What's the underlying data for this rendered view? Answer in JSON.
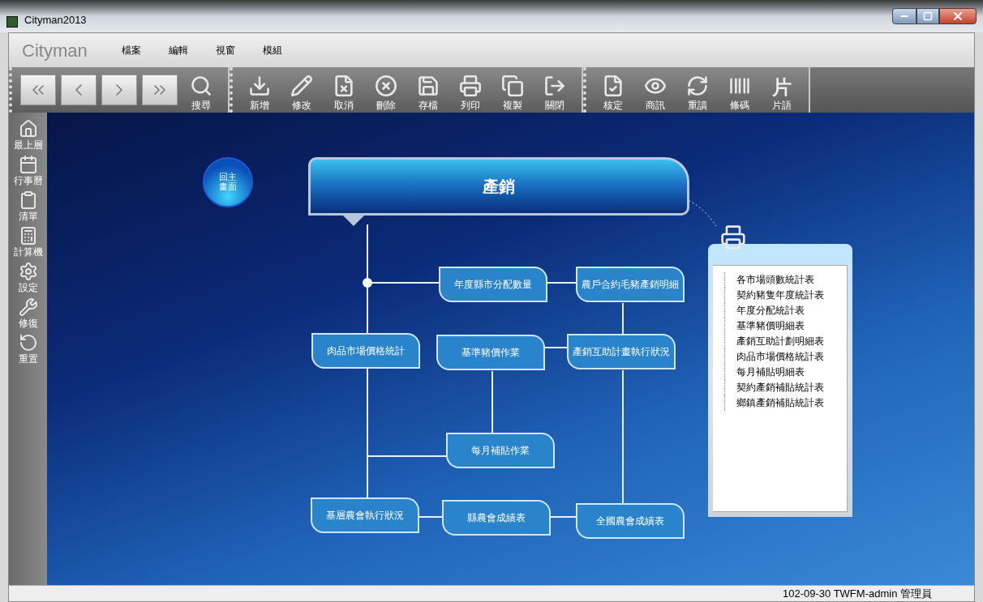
{
  "window": {
    "title": "Cityman2013"
  },
  "menu": {
    "brand": "Cityman",
    "items": [
      "檔案",
      "編輯",
      "視窗",
      "模組"
    ]
  },
  "toolbar": {
    "groups": [
      [
        {
          "kind": "nav"
        },
        {
          "kind": "nav"
        },
        {
          "kind": "nav"
        },
        {
          "kind": "nav"
        },
        {
          "kind": "tool",
          "label": "搜尋"
        }
      ],
      [
        {
          "kind": "tool",
          "label": "新增"
        },
        {
          "kind": "tool",
          "label": "修改"
        },
        {
          "kind": "tool",
          "label": "取消"
        },
        {
          "kind": "tool",
          "label": "刪除"
        },
        {
          "kind": "tool",
          "label": "存檔"
        },
        {
          "kind": "tool",
          "label": "列印"
        },
        {
          "kind": "tool",
          "label": "複製"
        },
        {
          "kind": "tool",
          "label": "關閉"
        }
      ],
      [
        {
          "kind": "tool",
          "label": "核定"
        },
        {
          "kind": "tool",
          "label": "商訊"
        },
        {
          "kind": "tool",
          "label": "重讀"
        },
        {
          "kind": "tool",
          "label": "條碼"
        },
        {
          "kind": "glyph",
          "glyph": "片",
          "label": "片語"
        }
      ]
    ]
  },
  "sidebar": {
    "items": [
      "最上層",
      "行事曆",
      "清單",
      "計算機",
      "設定",
      "修復",
      "重置"
    ]
  },
  "home_button": {
    "label": "回主畫面"
  },
  "diagram": {
    "title": "產銷",
    "nodes": [
      "年度縣市分配數量",
      "農戶合約毛豬產銷明細",
      "肉品市場價格統計",
      "基準豬價作業",
      "產銷互助計畫執行狀況",
      "每月補貼作業",
      "基層農會執行狀況",
      "縣農會成績表",
      "全國農會成績表"
    ]
  },
  "reports": {
    "items": [
      "各市場頭數統計表",
      "契約豬隻年度統計表",
      "年度分配統計表",
      "基準豬價明細表",
      "產銷互助計劃明細表",
      "肉品市場價格統計表",
      "每月補貼明細表",
      "契約產銷補貼統計表",
      "鄉鎮產銷補貼統計表"
    ]
  },
  "status_bar": {
    "text": "102-09-30 TWFM-admin 管理員"
  }
}
